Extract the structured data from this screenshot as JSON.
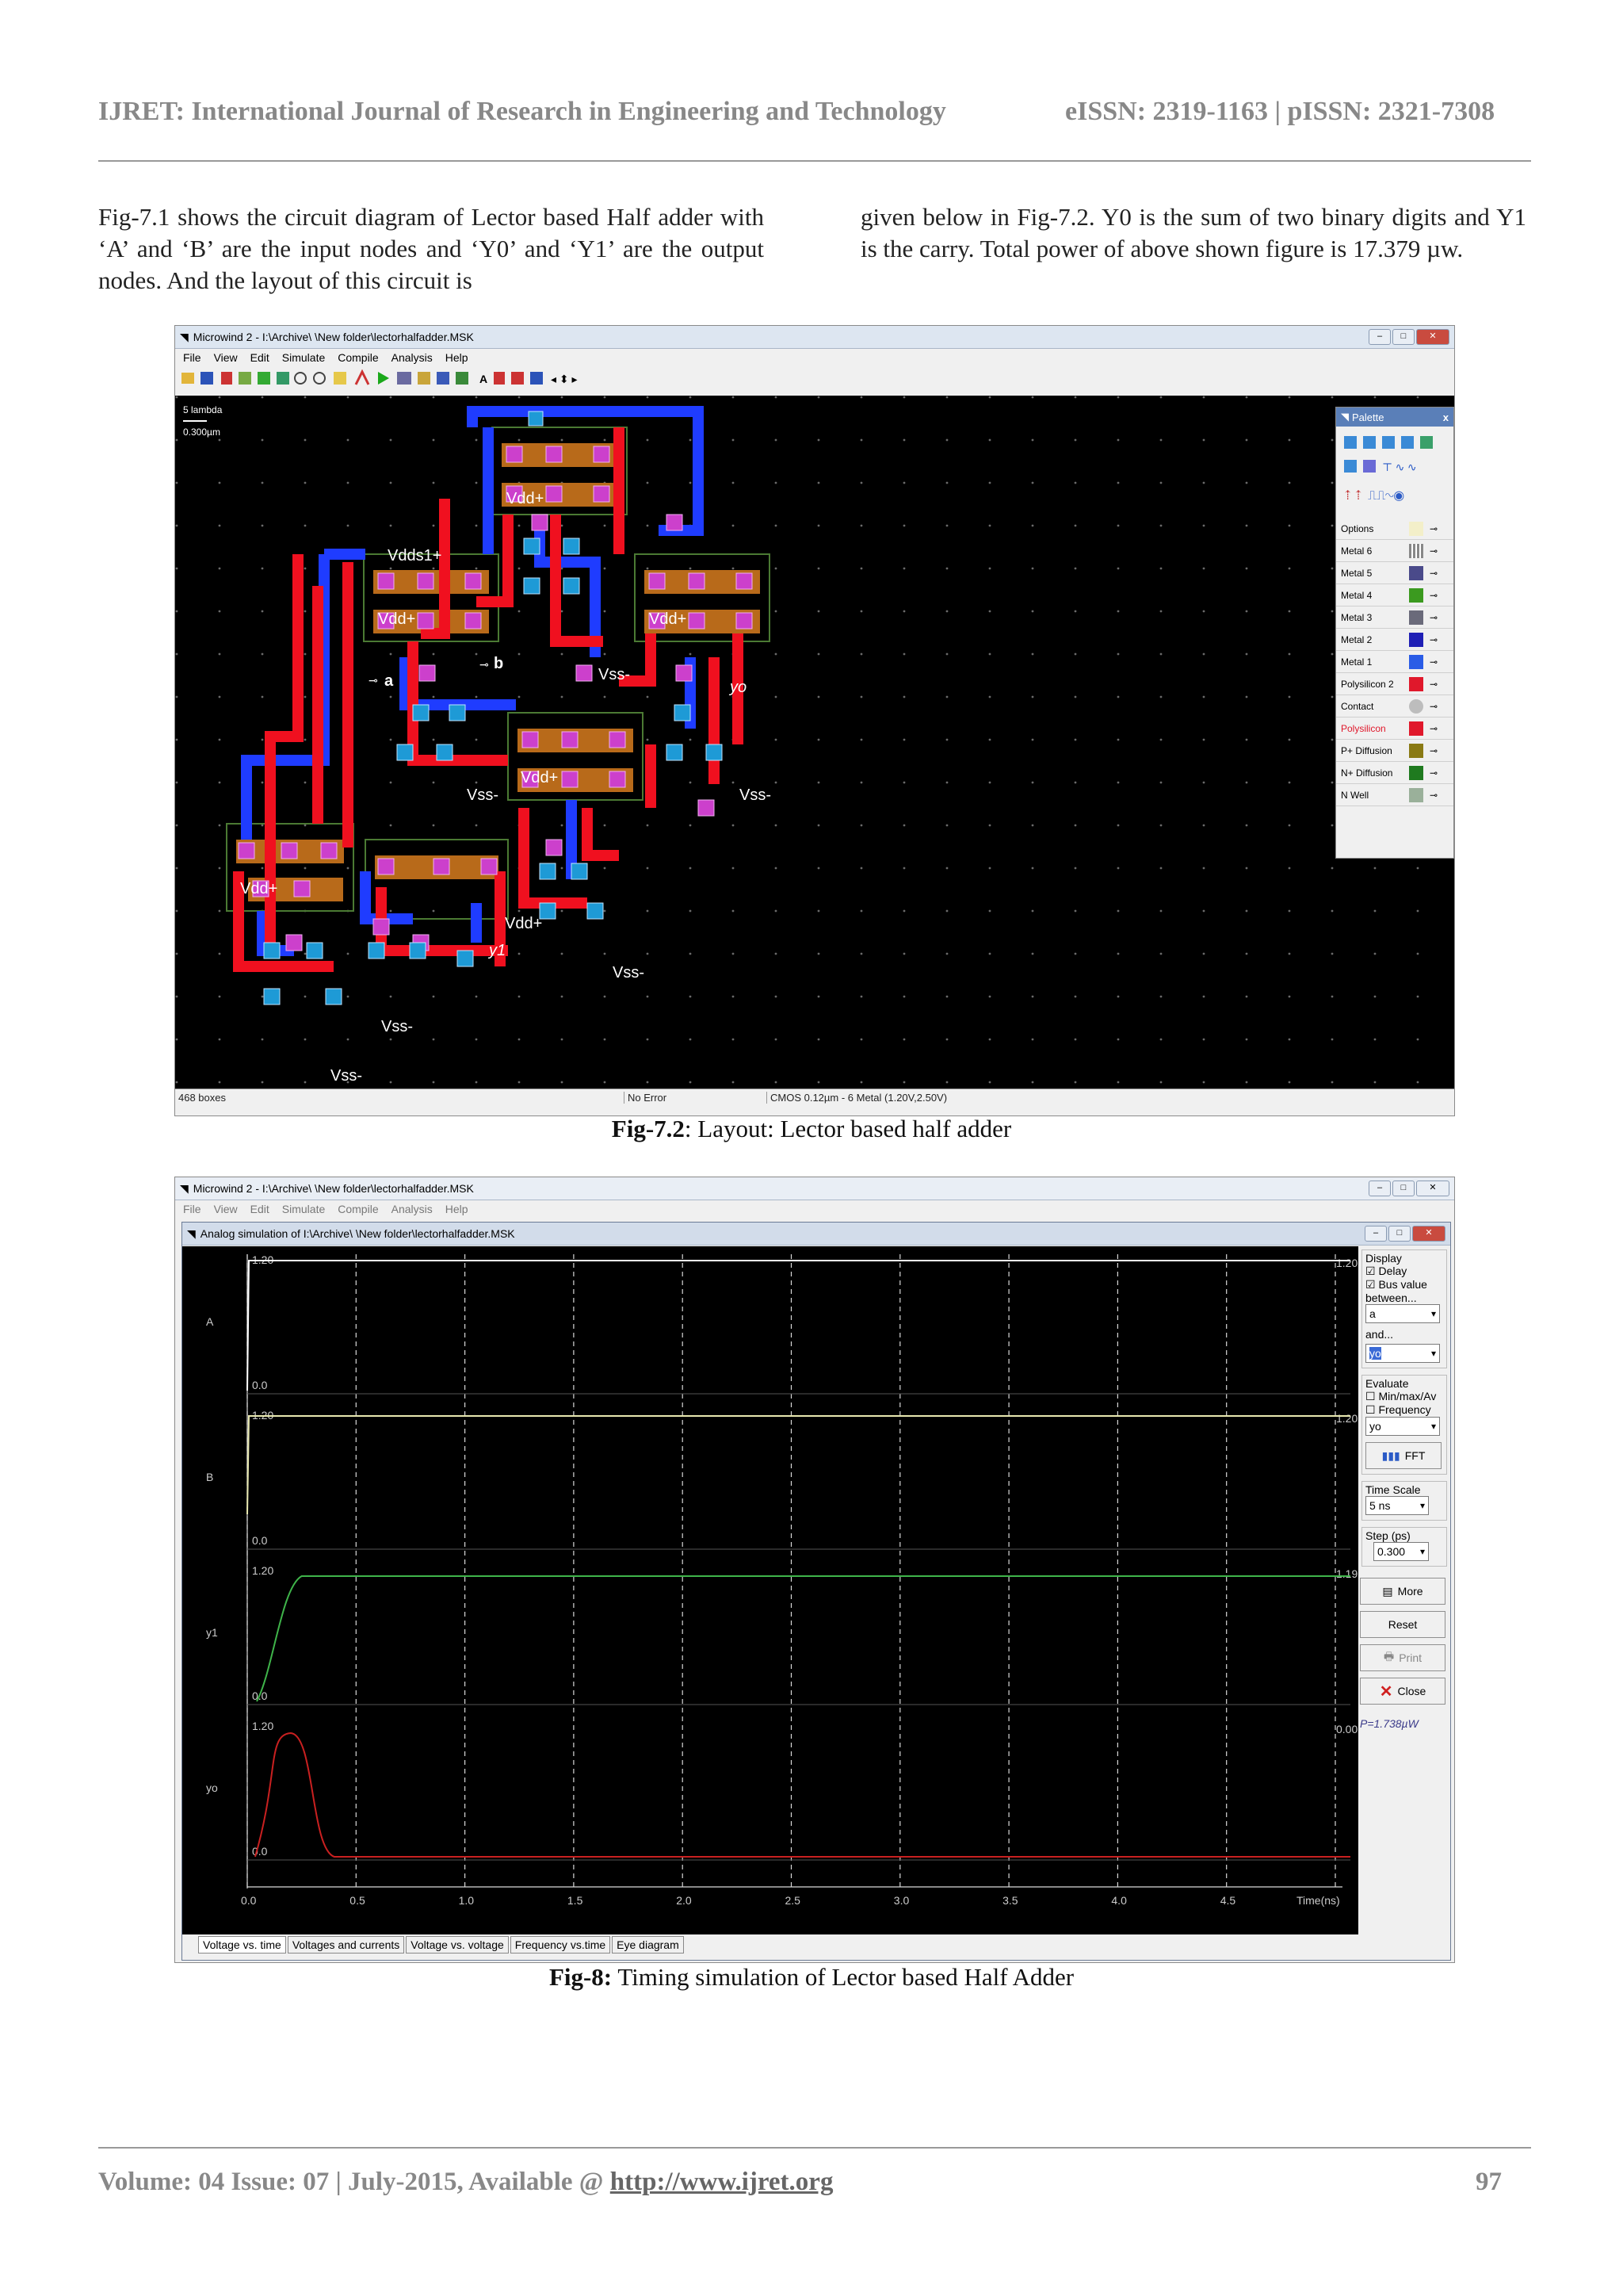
{
  "header": {
    "journal": "IJRET: International Journal of Research in Engineering and Technology",
    "issn": "eISSN: 2319-1163 | pISSN: 2321-7308"
  },
  "body": {
    "left_paragraph": "Fig-7.1 shows the circuit diagram of Lector based Half adder with ‘A’ and ‘B’ are the input nodes and ‘Y0’ and ‘Y1’ are the output nodes. And the layout of this circuit is",
    "right_paragraph": "given below in Fig-7.2. Y0 is the sum of two binary digits and Y1 is the carry. Total power of above shown figure is 17.379 µw."
  },
  "fig72": {
    "window_title": "Microwind 2 - I:\\Archive\\ \\New folder\\lectorhalfadder.MSK",
    "menu": [
      "File",
      "View",
      "Edit",
      "Simulate",
      "Compile",
      "Analysis",
      "Help"
    ],
    "scale_label1": "5 lambda",
    "scale_label2": "0.300µm",
    "node_labels": {
      "vdds1": "Vdds1+",
      "vdd": "Vdd+",
      "vss": "Vss-",
      "a": "a",
      "b": "b",
      "yo": "yo",
      "y1": "y1"
    },
    "palette": {
      "title": "Palette",
      "close": "x",
      "layers": [
        {
          "label": "Options",
          "color": "#f3efc9"
        },
        {
          "label": "Metal 6",
          "color": "#9a9a9a"
        },
        {
          "label": "Metal 5",
          "color": "#4a4a8a"
        },
        {
          "label": "Metal 4",
          "color": "#3b9a1f"
        },
        {
          "label": "Metal 3",
          "color": "#6a6a7a"
        },
        {
          "label": "Metal 2",
          "color": "#1f1fb5"
        },
        {
          "label": "Metal 1",
          "color": "#2a5ce6"
        },
        {
          "label": "Polysilicon 2",
          "color": "#e0182b"
        },
        {
          "label": "Contact",
          "color": "#bdbdbd"
        },
        {
          "label": "Polysilicon",
          "color": "#e0182b"
        },
        {
          "label": "P+ Diffusion",
          "color": "#8a7a14"
        },
        {
          "label": "N+ Diffusion",
          "color": "#1f7a1f"
        },
        {
          "label": "N Well",
          "color": "#9ab09a"
        }
      ]
    },
    "status": {
      "boxes": "468 boxes",
      "error": "No Error",
      "tech": "CMOS 0.12µm - 6 Metal (1.20V,2.50V)"
    },
    "caption_bold": "Fig-7.2",
    "caption_text": ": Layout: Lector based half adder"
  },
  "fig8": {
    "outer_title": "Microwind 2 - I:\\Archive\\ \\New folder\\lectorhalfadder.MSK",
    "menu": [
      "File",
      "View",
      "Edit",
      "Simulate",
      "Compile",
      "Analysis",
      "Help"
    ],
    "inner_title": "Analog simulation of I:\\Archive\\ \\New folder\\lectorhalfadder.MSK",
    "signals": [
      {
        "name": "A",
        "hi": "1.20",
        "lo": "0.0",
        "right": "1.20"
      },
      {
        "name": "B",
        "hi": "1.20",
        "lo": "0.0",
        "right": "1.20"
      },
      {
        "name": "y1",
        "hi": "1.20",
        "lo": "0.0",
        "right": "1.19"
      },
      {
        "name": "yo",
        "hi": "1.20",
        "lo": "0.0",
        "right": "0.00"
      }
    ],
    "x_ticks": [
      "0.0",
      "0.5",
      "1.0",
      "1.5",
      "2.0",
      "2.5",
      "3.0",
      "3.5",
      "4.0",
      "4.5"
    ],
    "x_unit": "Time(ns)",
    "side": {
      "display": "Display",
      "delay": "Delay",
      "bus": "Bus value",
      "between": "between...",
      "sel1": "a",
      "and": "and...",
      "sel2": "yo",
      "evaluate": "Evaluate",
      "minmax": "Min/max/Av",
      "freq": "Frequency",
      "sel3": "yo",
      "fft": "FFT",
      "timescale": "Time Scale",
      "ts_val": "5 ns",
      "step": "Step (ps)",
      "step_val": "0.300",
      "more": "More",
      "reset": "Reset",
      "print": "Print",
      "close": "Close",
      "power": "P=1.738µW"
    },
    "tabs": [
      "Voltage vs. time",
      "Voltages and currents",
      "Voltage vs. voltage",
      "Frequency vs.time",
      "Eye diagram"
    ],
    "caption_bold": "Fig-8:",
    "caption_text": " Timing simulation of Lector based Half Adder"
  },
  "footer": {
    "left": "Volume: 04 Issue: 07 | July-2015, Available @ ",
    "link": "http://www.ijret.org",
    "page": "97"
  }
}
